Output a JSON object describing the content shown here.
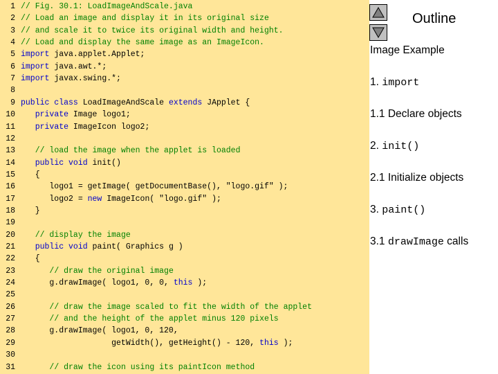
{
  "outline": {
    "title": "Outline",
    "nav_up_icon": "triangle-up-icon",
    "nav_down_icon": "triangle-down-icon"
  },
  "side_items": [
    {
      "parts": [
        {
          "t": "Image Example",
          "mono": false
        }
      ]
    },
    {
      "parts": [
        {
          "t": "1. ",
          "mono": false
        },
        {
          "t": "import",
          "mono": true
        }
      ]
    },
    {
      "parts": [
        {
          "t": "1.1 Declare objects",
          "mono": false
        }
      ]
    },
    {
      "parts": [
        {
          "t": "2. ",
          "mono": false
        },
        {
          "t": "init()",
          "mono": true
        }
      ]
    },
    {
      "parts": [
        {
          "t": "2.1 Initialize objects",
          "mono": false
        }
      ]
    },
    {
      "parts": [
        {
          "t": "3. ",
          "mono": false
        },
        {
          "t": "paint()",
          "mono": true
        }
      ]
    },
    {
      "parts": [
        {
          "t": "3.1 ",
          "mono": false
        },
        {
          "t": "drawImage",
          "mono": true
        },
        {
          "t": " calls",
          "mono": false
        }
      ]
    }
  ],
  "code_lines": [
    {
      "n": "1",
      "segs": [
        {
          "t": "// Fig. 30.1: LoadImageAndScale.java",
          "c": "comment"
        }
      ]
    },
    {
      "n": "2",
      "segs": [
        {
          "t": "// Load an image and display it in its original size",
          "c": "comment"
        }
      ]
    },
    {
      "n": "3",
      "segs": [
        {
          "t": "// and scale it to twice its original width and height.",
          "c": "comment"
        }
      ]
    },
    {
      "n": "4",
      "segs": [
        {
          "t": "// Load and display the same image as an ImageIcon.",
          "c": "comment"
        }
      ]
    },
    {
      "n": "5",
      "segs": [
        {
          "t": "import",
          "c": "kw"
        },
        {
          "t": " java.applet.Applet;",
          "c": "plain"
        }
      ]
    },
    {
      "n": "6",
      "segs": [
        {
          "t": "import",
          "c": "kw"
        },
        {
          "t": " java.awt.*;",
          "c": "plain"
        }
      ]
    },
    {
      "n": "7",
      "segs": [
        {
          "t": "import",
          "c": "kw"
        },
        {
          "t": " javax.swing.*;",
          "c": "plain"
        }
      ]
    },
    {
      "n": "8",
      "segs": []
    },
    {
      "n": "9",
      "segs": [
        {
          "t": "public class",
          "c": "kw"
        },
        {
          "t": " LoadImageAndScale ",
          "c": "plain"
        },
        {
          "t": "extends",
          "c": "kw"
        },
        {
          "t": " JApplet {",
          "c": "plain"
        }
      ]
    },
    {
      "n": "10",
      "segs": [
        {
          "t": "   ",
          "c": "plain"
        },
        {
          "t": "private",
          "c": "kw"
        },
        {
          "t": " Image logo1;",
          "c": "plain"
        }
      ]
    },
    {
      "n": "11",
      "segs": [
        {
          "t": "   ",
          "c": "plain"
        },
        {
          "t": "private",
          "c": "kw"
        },
        {
          "t": " ImageIcon logo2;",
          "c": "plain"
        }
      ]
    },
    {
      "n": "12",
      "segs": []
    },
    {
      "n": "13",
      "segs": [
        {
          "t": "   ",
          "c": "plain"
        },
        {
          "t": "// load the image when the applet is loaded",
          "c": "comment"
        }
      ]
    },
    {
      "n": "14",
      "segs": [
        {
          "t": "   ",
          "c": "plain"
        },
        {
          "t": "public void",
          "c": "kw"
        },
        {
          "t": " init()",
          "c": "plain"
        }
      ]
    },
    {
      "n": "15",
      "segs": [
        {
          "t": "   {",
          "c": "plain"
        }
      ]
    },
    {
      "n": "16",
      "segs": [
        {
          "t": "      logo1 = getImage( getDocumentBase(), \"logo.gif\" );",
          "c": "plain"
        }
      ]
    },
    {
      "n": "17",
      "segs": [
        {
          "t": "      logo2 = ",
          "c": "plain"
        },
        {
          "t": "new",
          "c": "kw"
        },
        {
          "t": " ImageIcon( \"logo.gif\" );",
          "c": "plain"
        }
      ]
    },
    {
      "n": "18",
      "segs": [
        {
          "t": "   }",
          "c": "plain"
        }
      ]
    },
    {
      "n": "19",
      "segs": []
    },
    {
      "n": "20",
      "segs": [
        {
          "t": "   ",
          "c": "plain"
        },
        {
          "t": "// display the image",
          "c": "comment"
        }
      ]
    },
    {
      "n": "21",
      "segs": [
        {
          "t": "   ",
          "c": "plain"
        },
        {
          "t": "public void",
          "c": "kw"
        },
        {
          "t": " paint( Graphics g )",
          "c": "plain"
        }
      ]
    },
    {
      "n": "22",
      "segs": [
        {
          "t": "   {",
          "c": "plain"
        }
      ]
    },
    {
      "n": "23",
      "segs": [
        {
          "t": "      ",
          "c": "plain"
        },
        {
          "t": "// draw the original image",
          "c": "comment"
        }
      ]
    },
    {
      "n": "24",
      "segs": [
        {
          "t": "      g.drawImage( logo1, 0, 0, ",
          "c": "plain"
        },
        {
          "t": "this",
          "c": "kw"
        },
        {
          "t": " );",
          "c": "plain"
        }
      ]
    },
    {
      "n": "25",
      "segs": []
    },
    {
      "n": "26",
      "segs": [
        {
          "t": "      ",
          "c": "plain"
        },
        {
          "t": "// draw the image scaled to fit the width of the applet",
          "c": "comment"
        }
      ]
    },
    {
      "n": "27",
      "segs": [
        {
          "t": "      ",
          "c": "plain"
        },
        {
          "t": "// and the height of the applet minus 120 pixels",
          "c": "comment"
        }
      ]
    },
    {
      "n": "28",
      "segs": [
        {
          "t": "      g.drawImage( logo1, 0, 120,",
          "c": "plain"
        }
      ]
    },
    {
      "n": "29",
      "segs": [
        {
          "t": "                   getWidth(), getHeight() - 120, ",
          "c": "plain"
        },
        {
          "t": "this",
          "c": "kw"
        },
        {
          "t": " );",
          "c": "plain"
        }
      ]
    },
    {
      "n": "30",
      "segs": []
    },
    {
      "n": "31",
      "segs": [
        {
          "t": "      ",
          "c": "plain"
        },
        {
          "t": "// draw the icon using its paintIcon method",
          "c": "comment"
        }
      ]
    }
  ]
}
